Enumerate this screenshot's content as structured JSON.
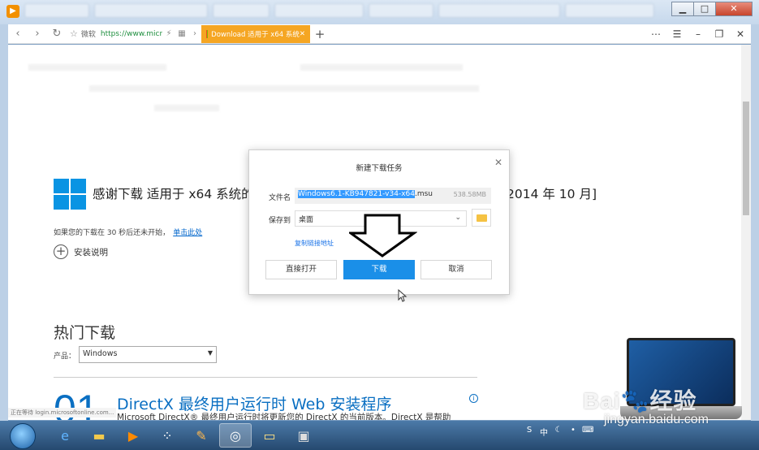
{
  "window": {
    "minimize": "▁",
    "maximize": "□",
    "close": "✕"
  },
  "browser": {
    "address_label": "微软",
    "address_url": "https://www.micr",
    "tab_title": "Download 适用于 x64 系统",
    "tab_close": "✕",
    "new_tab": "+"
  },
  "page": {
    "headline": "感谢下载 适用于 x64 系统的",
    "headline_tail": "2014 年 10 月]",
    "note": "如果您的下载在 30 秒后还未开始，",
    "note_link": "单击此处",
    "install_label": "安装说明",
    "hot_downloads_title": "热门下载",
    "product_label": "产品：",
    "product_value": "Windows",
    "item_number": "01",
    "item_title": "DirectX 最终用户运行时 Web 安装程序",
    "item_desc": "Microsoft DirectX® 最终用户运行时将更新您的 DirectX 的当前版本。DirectX 是帮助",
    "status_text": "正在等待 login.microsoftonline.com..."
  },
  "dialog": {
    "title": "新建下载任务",
    "filename_label": "文件名",
    "filename_selected": "Windows6.1-KB947821-v34-x64",
    "filename_ext": ".msu",
    "file_size": "538.58MB",
    "saveto_label": "保存到",
    "saveto_value": "桌面",
    "copy_link": "复制链接地址",
    "open_button": "直接打开",
    "download_button": "下载",
    "cancel_button": "取消"
  },
  "watermark": {
    "baidu": "Bai",
    "baidu_tail": "经验",
    "jingyan": "jingyan.baidu.com"
  },
  "colors": {
    "accent_tab": "#f5a623",
    "primary_button": "#1a8fe8",
    "link": "#0066cc",
    "windows_logo": "#0a94e3"
  }
}
